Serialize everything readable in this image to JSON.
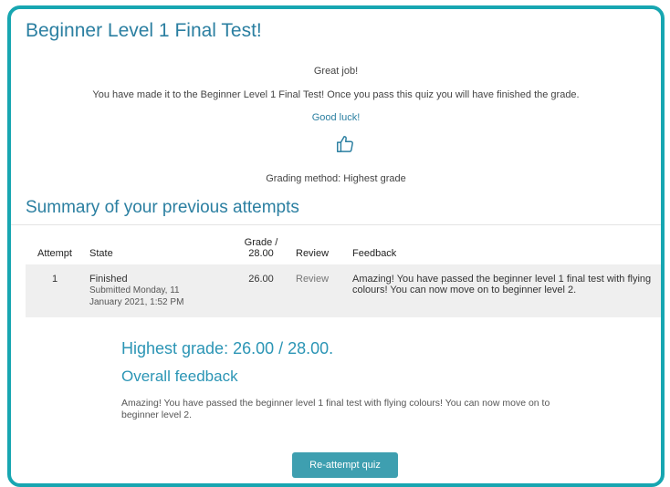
{
  "header": {
    "title": "Beginner Level 1 Final Test!"
  },
  "intro": {
    "great_job": "Great job!",
    "message": "You have made it to the Beginner Level 1 Final Test! Once you pass this quiz you will have finished the grade.",
    "good_luck": "Good luck!",
    "icon": "thumbs-up-icon",
    "grading_method": "Grading method: Highest grade"
  },
  "summary": {
    "title": "Summary of your previous attempts",
    "columns": {
      "attempt": "Attempt",
      "state": "State",
      "grade_line1": "Grade /",
      "grade_line2": "28.00",
      "review": "Review",
      "feedback": "Feedback"
    },
    "rows": [
      {
        "attempt": "1",
        "state": "Finished",
        "submitted_line1": "Submitted Monday, 11",
        "submitted_line2": "January 2021, 1:52 PM",
        "grade": "26.00",
        "review": "Review",
        "feedback": "Amazing! You have passed the beginner level 1 final test with flying colours! You can now move on to beginner level 2."
      }
    ]
  },
  "result": {
    "highest_grade": "Highest grade: 26.00 / 28.00.",
    "overall_title": "Overall feedback",
    "overall_text": "Amazing! You have passed the beginner level 1 final test with flying colours! You can now move on to beginner level 2."
  },
  "actions": {
    "reattempt": "Re-attempt quiz"
  },
  "colors": {
    "frame": "#17a6b1",
    "title": "#2b7fa1",
    "button": "#3e9fb0",
    "row_bg": "#efefef"
  }
}
